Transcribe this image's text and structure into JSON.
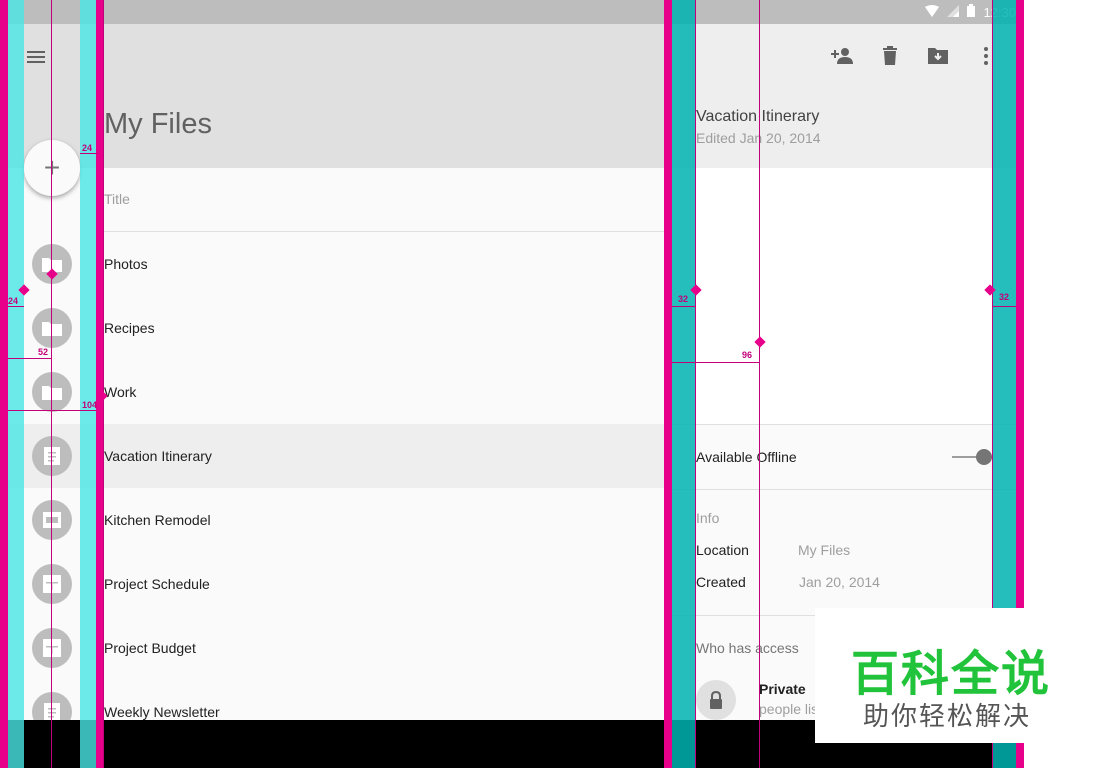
{
  "status_bar": {
    "time": "12:30"
  },
  "app": {
    "title": "My Files"
  },
  "list": {
    "header": "Title",
    "items": [
      {
        "label": "Photos",
        "icon": "folder-icon"
      },
      {
        "label": "Recipes",
        "icon": "folder-icon"
      },
      {
        "label": "Work",
        "icon": "folder-icon"
      },
      {
        "label": "Vacation Itinerary",
        "icon": "document-icon",
        "selected": true
      },
      {
        "label": "Kitchen Remodel",
        "icon": "slides-icon"
      },
      {
        "label": "Project Schedule",
        "icon": "spreadsheet-icon"
      },
      {
        "label": "Project Budget",
        "icon": "spreadsheet-icon"
      },
      {
        "label": "Weekly Newsletter",
        "icon": "document-icon"
      }
    ]
  },
  "detail": {
    "title": "Vacation Itinerary",
    "subtitle": "Edited Jan 20, 2014",
    "actions": [
      "add-person-icon",
      "delete-icon",
      "move-to-folder-icon",
      "more-vert-icon"
    ],
    "offline_label": "Available Offline",
    "offline_enabled": true,
    "info": {
      "title": "Info",
      "location_label": "Location",
      "location_value": "My Files",
      "created_label": "Created",
      "created_value": "Jan 20, 2014"
    },
    "access": {
      "title": "Who has access",
      "name": "Private",
      "sub": "people lis"
    }
  },
  "redline_specs": {
    "fab_offset": "24",
    "left_margin": "24",
    "avatar_center": "52",
    "text_keyline": "104",
    "detail_padding_left": "32",
    "detail_padding_right": "32",
    "detail_keyline": "96"
  },
  "watermark": {
    "line1": "百科全说",
    "line2": "助你轻松解决"
  },
  "colors": {
    "accent": "#e6008a",
    "guide_cyan": "#48e6e6",
    "guide_teal": "#00b2b2",
    "watermark_green": "#21c33a"
  }
}
